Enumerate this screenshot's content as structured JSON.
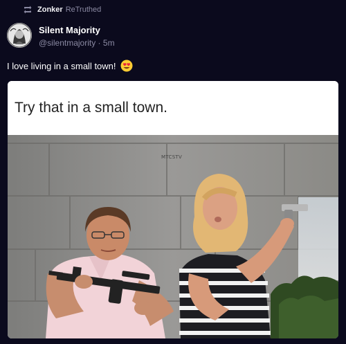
{
  "retruth": {
    "user": "Zonker",
    "action": "ReTruthed",
    "icon": "retruth-icon"
  },
  "post": {
    "author_name": "Silent Majority",
    "author_handle": "@silentmajority",
    "separator": "·",
    "time_ago": "5m",
    "text": "I love living in a small town!",
    "emoji": "smiling-face-with-heart-eyes"
  },
  "media": {
    "caption": "Try that in a small town.",
    "watermark": "MTCSTV"
  },
  "colors": {
    "background": "#0b0a1d",
    "muted_text": "#8b8aa3",
    "accent": "#5448ee"
  }
}
